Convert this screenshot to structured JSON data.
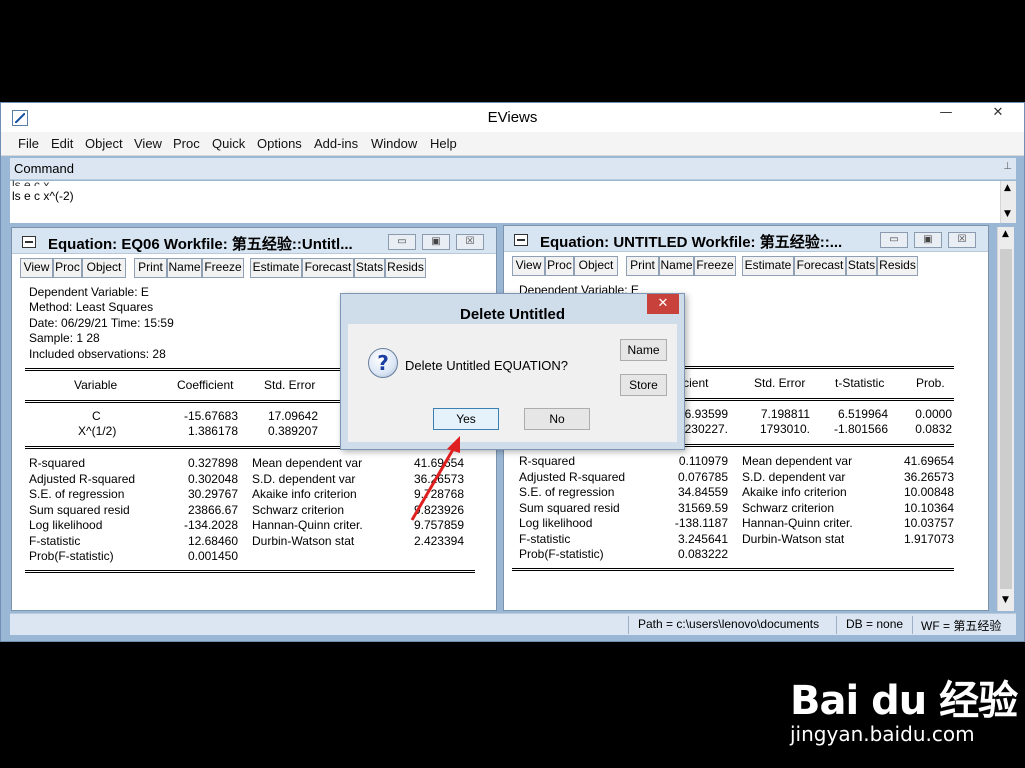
{
  "app": {
    "title": "EViews",
    "window_buttons": {
      "minimize": "—",
      "close": "✕"
    },
    "menu": [
      "File",
      "Edit",
      "Object",
      "View",
      "Proc",
      "Quick",
      "Options",
      "Add-ins",
      "Window",
      "Help"
    ],
    "command_label": "Command",
    "command_lines": [
      "ls e c x...",
      "ls e c x^(-2)"
    ]
  },
  "toolbar_buttons": [
    "View",
    "Proc",
    "Object",
    "Print",
    "Name",
    "Freeze",
    "Estimate",
    "Forecast",
    "Stats",
    "Resids"
  ],
  "left_window": {
    "title": "Equation: EQ06   Workfile: 第五经验::Untitl...",
    "header": [
      "Dependent Variable: E",
      "Method: Least Squares",
      "Date: 06/29/21   Time: 15:59",
      "Sample: 1 28",
      "Included observations: 28"
    ],
    "columns": [
      "Variable",
      "Coefficient",
      "Std. Error"
    ],
    "rows": [
      {
        "variable": "C",
        "coefficient": "-15.67683",
        "std_error": "17.09642"
      },
      {
        "variable": "X^(1/2)",
        "coefficient": "1.386178",
        "std_error": "0.389207"
      }
    ],
    "stats_left": [
      {
        "label": "R-squared",
        "value": "0.327898"
      },
      {
        "label": "Adjusted R-squared",
        "value": "0.302048"
      },
      {
        "label": "S.E. of regression",
        "value": "30.29767"
      },
      {
        "label": "Sum squared resid",
        "value": "23866.67"
      },
      {
        "label": "Log likelihood",
        "value": "-134.2028"
      },
      {
        "label": "F-statistic",
        "value": "12.68460"
      },
      {
        "label": "Prob(F-statistic)",
        "value": "0.001450"
      }
    ],
    "stats_right": [
      {
        "label": "Mean dependent var",
        "value": "41.69654"
      },
      {
        "label": "S.D. dependent var",
        "value": "36.26573"
      },
      {
        "label": "Akaike info criterion",
        "value": "9.728768"
      },
      {
        "label": "Schwarz criterion",
        "value": "9.823926"
      },
      {
        "label": "Hannan-Quinn criter.",
        "value": "9.757859"
      },
      {
        "label": "Durbin-Watson stat",
        "value": "2.423394"
      }
    ]
  },
  "right_window": {
    "title": "Equation: UNTITLED   Workfile: 第五经验::...",
    "header": [
      "Dependent Variable: E"
    ],
    "columns": [
      "Coefficient",
      "Std. Error",
      "t-Statistic",
      "Prob."
    ],
    "rows": [
      {
        "coefficient": "46.93599",
        "std_error": "7.198811",
        "t_stat": "6.519964",
        "prob": "0.0000"
      },
      {
        "coefficient": "-3230227.",
        "std_error": "1793010.",
        "t_stat": "-1.801566",
        "prob": "0.0832"
      }
    ],
    "stats_left": [
      {
        "label": "R-squared",
        "value": "0.110979"
      },
      {
        "label": "Adjusted R-squared",
        "value": "0.076785"
      },
      {
        "label": "S.E. of regression",
        "value": "34.84559"
      },
      {
        "label": "Sum squared resid",
        "value": "31569.59"
      },
      {
        "label": "Log likelihood",
        "value": "-138.1187"
      },
      {
        "label": "F-statistic",
        "value": "3.245641"
      },
      {
        "label": "Prob(F-statistic)",
        "value": "0.083222"
      }
    ],
    "stats_right": [
      {
        "label": "Mean dependent var",
        "value": "41.69654"
      },
      {
        "label": "S.D. dependent var",
        "value": "36.26573"
      },
      {
        "label": "Akaike info criterion",
        "value": "10.00848"
      },
      {
        "label": "Schwarz criterion",
        "value": "10.10364"
      },
      {
        "label": "Hannan-Quinn criter.",
        "value": "10.03757"
      },
      {
        "label": "Durbin-Watson stat",
        "value": "1.917073"
      }
    ]
  },
  "status_bar": {
    "path": "Path = c:\\users\\lenovo\\documents",
    "db": "DB = none",
    "wf": "WF = 第五经验"
  },
  "dialog": {
    "title": "Delete Untitled",
    "close": "✕",
    "icon": "question-icon",
    "message": "Delete Untitled EQUATION?",
    "buttons": {
      "name": "Name",
      "store": "Store",
      "yes": "Yes",
      "no": "No"
    }
  },
  "watermark": {
    "logo": "Bai du 经验",
    "url": "jingyan.baidu.com"
  },
  "colors": {
    "annotation_arrow": "#e02020",
    "title_bar": "#d7e4f2",
    "dialog_close": "#c9413b"
  }
}
